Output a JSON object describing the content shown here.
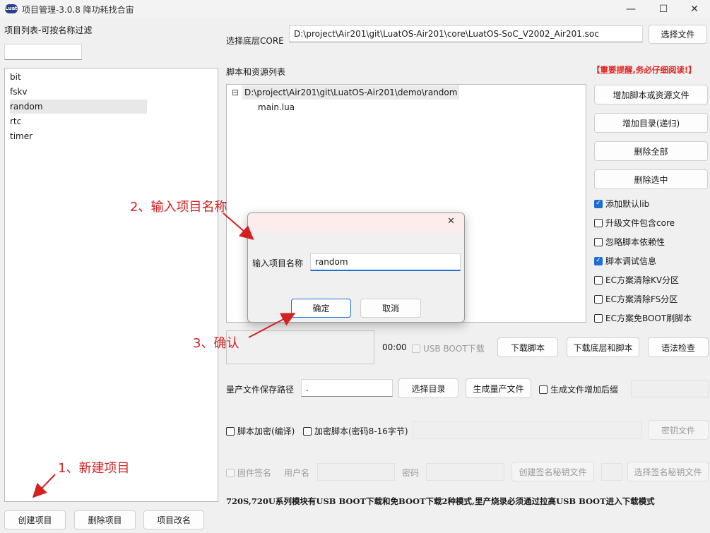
{
  "window": {
    "icon_text": "LuatOS",
    "title": "项目管理-3.0.8 降功耗找合宙",
    "minimize": "—",
    "maximize": "☐",
    "close": "✕"
  },
  "sidebar": {
    "title": "项目列表-可按名称过滤",
    "filter_value": "",
    "projects": [
      "bit",
      "fskv",
      "random",
      "rtc",
      "timer"
    ],
    "selected": "random",
    "buttons": {
      "create": "创建项目",
      "delete": "删除项目",
      "rename": "项目改名"
    }
  },
  "core": {
    "label": "选择底层CORE",
    "path": "D:\\project\\Air201\\git\\LuatOS-Air201\\core\\LuatOS-SoC_V2002_Air201.soc",
    "select_button": "选择文件"
  },
  "scripts": {
    "label": "脚本和资源列表",
    "warning": "【重要提醒,务必仔细阅读!】",
    "tree_toggle": "⊟",
    "folder": "D:\\project\\Air201\\git\\LuatOS-Air201\\demo\\random",
    "files": [
      "main.lua"
    ],
    "buttons": {
      "add_file": "增加脚本或资源文件",
      "add_dir": "增加目录(递归)",
      "delete_all": "删除全部",
      "delete_selected": "删除选中"
    },
    "options": [
      {
        "label": "添加默认lib",
        "checked": true
      },
      {
        "label": "升级文件包含core",
        "checked": false
      },
      {
        "label": "忽略脚本依赖性",
        "checked": false
      },
      {
        "label": "脚本调试信息",
        "checked": true
      },
      {
        "label": "EC方案清除KV分区",
        "checked": false
      },
      {
        "label": "EC方案清除FS分区",
        "checked": false
      },
      {
        "label": "EC方案免BOOT刷脚本",
        "checked": false
      }
    ]
  },
  "download": {
    "timer": "00:00",
    "usb_boot_label": "USB BOOT下载",
    "download_script": "下载脚本",
    "download_all": "下载底层和脚本",
    "syntax_check": "语法检查"
  },
  "mass_production": {
    "label": "量产文件保存路径",
    "path": ".",
    "select_dir": "选择目录",
    "generate": "生成量产文件",
    "suffix_label": "生成文件增加后缀",
    "suffix_value": ""
  },
  "encryption": {
    "compile_label": "脚本加密(编译)",
    "encrypt_label": "加密脚本(密码8-16字节)",
    "key_value": "",
    "key_button": "密钥文件"
  },
  "signing": {
    "firmware_sign": "固件签名",
    "username_label": "用户名",
    "password_label": "密码",
    "create_key": "创建签名秘钥文件",
    "select_key": "选择签名秘钥文件"
  },
  "footer_note": "720S,720U系列模块有USB BOOT下载和免BOOT下载2种模式,里产烧录必须通过拉高USB BOOT进入下载模式",
  "dialog": {
    "close": "✕",
    "label": "输入项目名称",
    "value": "random",
    "ok": "确定",
    "cancel": "取消"
  },
  "annotations": {
    "step1": "1、新建项目",
    "step2": "2、输入项目名称",
    "step3": "3、确认"
  },
  "colors": {
    "warning": "#e0201e",
    "annotation": "#d32020",
    "checkbox_on": "#1d6fd1"
  }
}
